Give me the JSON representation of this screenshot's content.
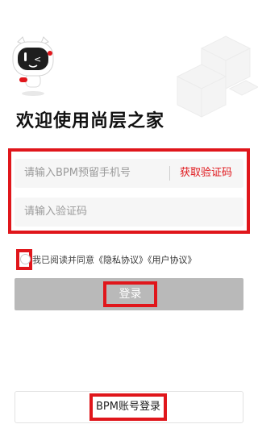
{
  "header": {
    "title": "欢迎使用尚层之家"
  },
  "form": {
    "phone_placeholder": "请输入BPM预留手机号",
    "get_code_label": "获取验证码",
    "code_placeholder": "请输入验证码"
  },
  "agreement": {
    "prefix": "我已阅读并同意",
    "privacy_link": "《隐私协议》",
    "user_link": "《用户协议》",
    "checked": false
  },
  "buttons": {
    "login_label": "登录",
    "bpm_login_label": "BPM账号登录"
  },
  "colors": {
    "accent": "#e0161b",
    "disabled_button": "#b9b9b9",
    "field_background": "#f6f6f6"
  },
  "icons": {
    "mascot": "robot-mascot-icon",
    "decoration": "cubes-decoration"
  }
}
